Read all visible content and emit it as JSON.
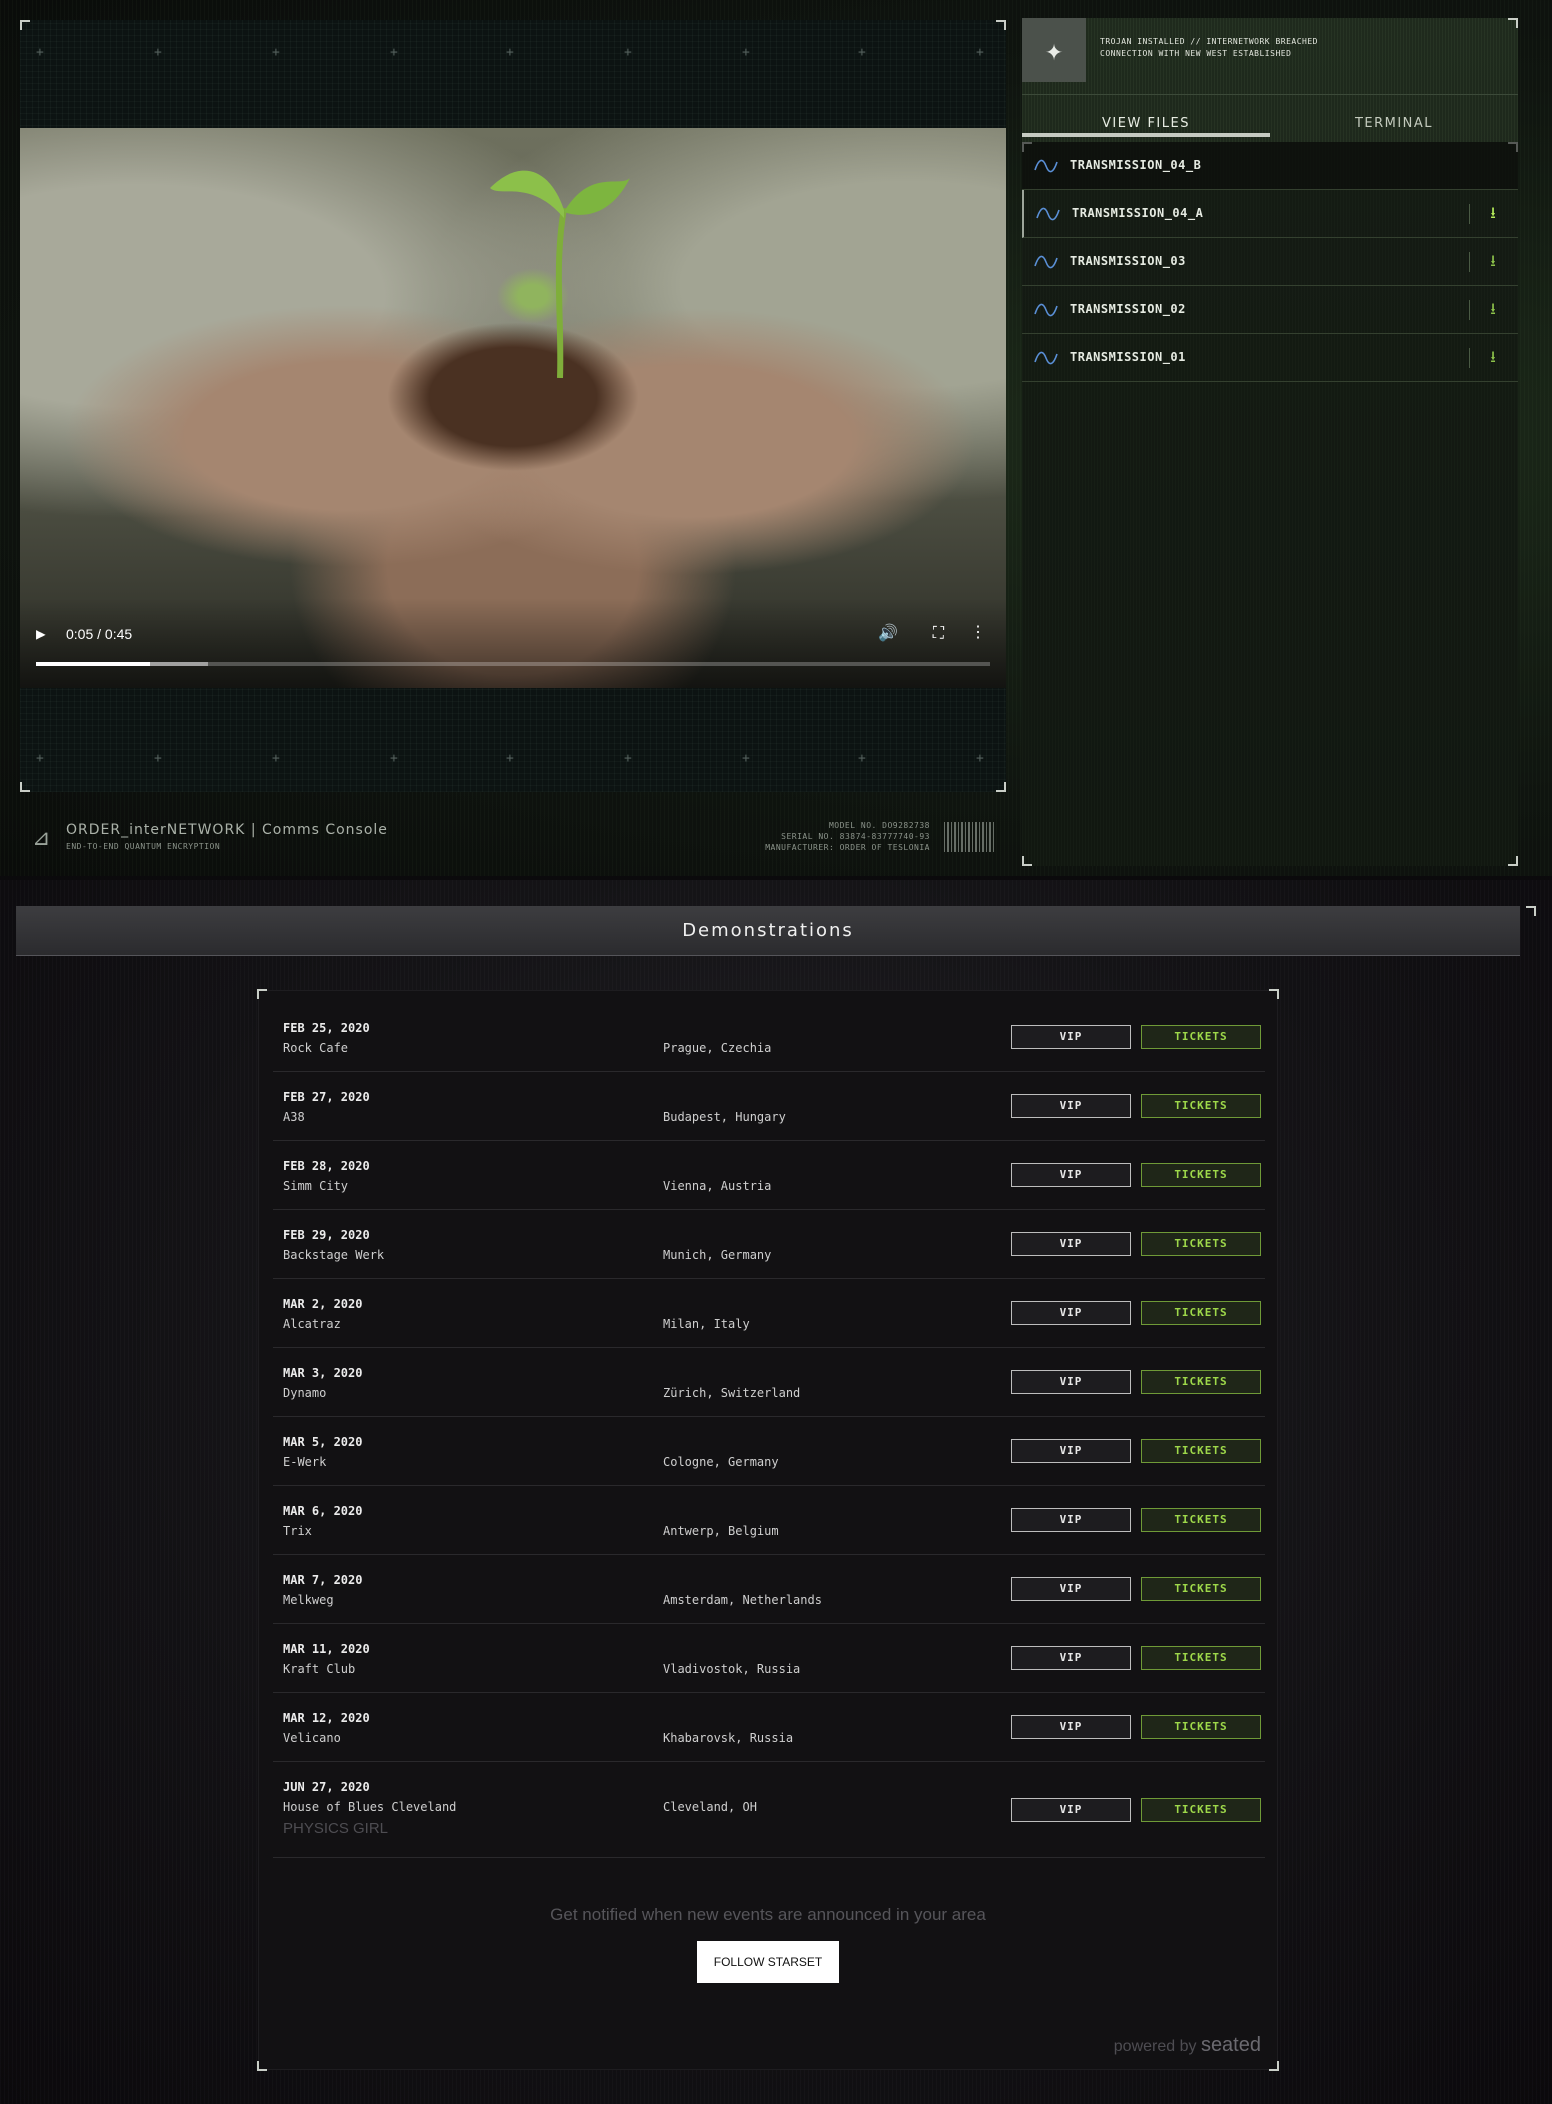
{
  "video": {
    "time": "0:05 / 0:45",
    "progress": 0.12,
    "buffered": 0.18
  },
  "console_footer": {
    "title": "ORDER_interNETWORK | Comms Console",
    "subtitle": "END-TO-END QUANTUM ENCRYPTION",
    "model": "MODEL NO. DO9282738",
    "serial": "SERIAL NO. 83874-83777740-93",
    "manufacturer": "MANUFACTURER: ORDER OF TESLONIA"
  },
  "side_panel": {
    "status_line1": "TROJAN INSTALLED // INTERNETWORK BREACHED",
    "status_line2": "CONNECTION WITH NEW WEST ESTABLISHED",
    "tabs": [
      {
        "label": "VIEW FILES",
        "active": true
      },
      {
        "label": "TERMINAL",
        "active": false
      }
    ],
    "files": [
      {
        "name": "TRANSMISSION_04_B",
        "download": false
      },
      {
        "name": "TRANSMISSION_04_A",
        "download": true
      },
      {
        "name": "TRANSMISSION_03",
        "download": true
      },
      {
        "name": "TRANSMISSION_02",
        "download": true
      },
      {
        "name": "TRANSMISSION_01",
        "download": true
      }
    ]
  },
  "events": {
    "title": "Demonstrations",
    "vip_label": "VIP",
    "tickets_label": "TICKETS",
    "list": [
      {
        "date": "FEB 25, 2020",
        "venue": "Rock Cafe",
        "location": "Prague, Czechia"
      },
      {
        "date": "FEB 27, 2020",
        "venue": "A38",
        "location": "Budapest, Hungary"
      },
      {
        "date": "FEB 28, 2020",
        "venue": "Simm City",
        "location": "Vienna, Austria"
      },
      {
        "date": "FEB 29, 2020",
        "venue": "Backstage Werk",
        "location": "Munich, Germany"
      },
      {
        "date": "MAR 2, 2020",
        "venue": "Alcatraz",
        "location": "Milan, Italy"
      },
      {
        "date": "MAR 3, 2020",
        "venue": "Dynamo",
        "location": "Zürich, Switzerland"
      },
      {
        "date": "MAR 5, 2020",
        "venue": "E-Werk",
        "location": "Cologne, Germany"
      },
      {
        "date": "MAR 6, 2020",
        "venue": "Trix",
        "location": "Antwerp, Belgium"
      },
      {
        "date": "MAR 7, 2020",
        "venue": "Melkweg",
        "location": "Amsterdam, Netherlands"
      },
      {
        "date": "MAR 11, 2020",
        "venue": "Kraft Club",
        "location": "Vladivostok, Russia"
      },
      {
        "date": "MAR 12, 2020",
        "venue": "Velicano",
        "location": "Khabarovsk, Russia"
      },
      {
        "date": "JUN 27, 2020",
        "venue": "House of Blues Cleveland",
        "location": "Cleveland, OH",
        "extra": "PHYSICS GIRL"
      }
    ],
    "notify_text": "Get notified when new events are announced in your area",
    "follow_label": "FOLLOW STARSET",
    "powered_prefix": "powered by",
    "powered_brand": "seated"
  },
  "icons": {
    "play": "play-icon",
    "volume": "volume-icon",
    "fullscreen": "fullscreen-icon",
    "more": "more-vertical-icon",
    "wave": "sine-wave-icon",
    "download": "download-icon",
    "logo": "starset-logo-icon"
  },
  "colors": {
    "accent_green": "#9ed84a",
    "wave_blue": "#5a8fd6"
  }
}
